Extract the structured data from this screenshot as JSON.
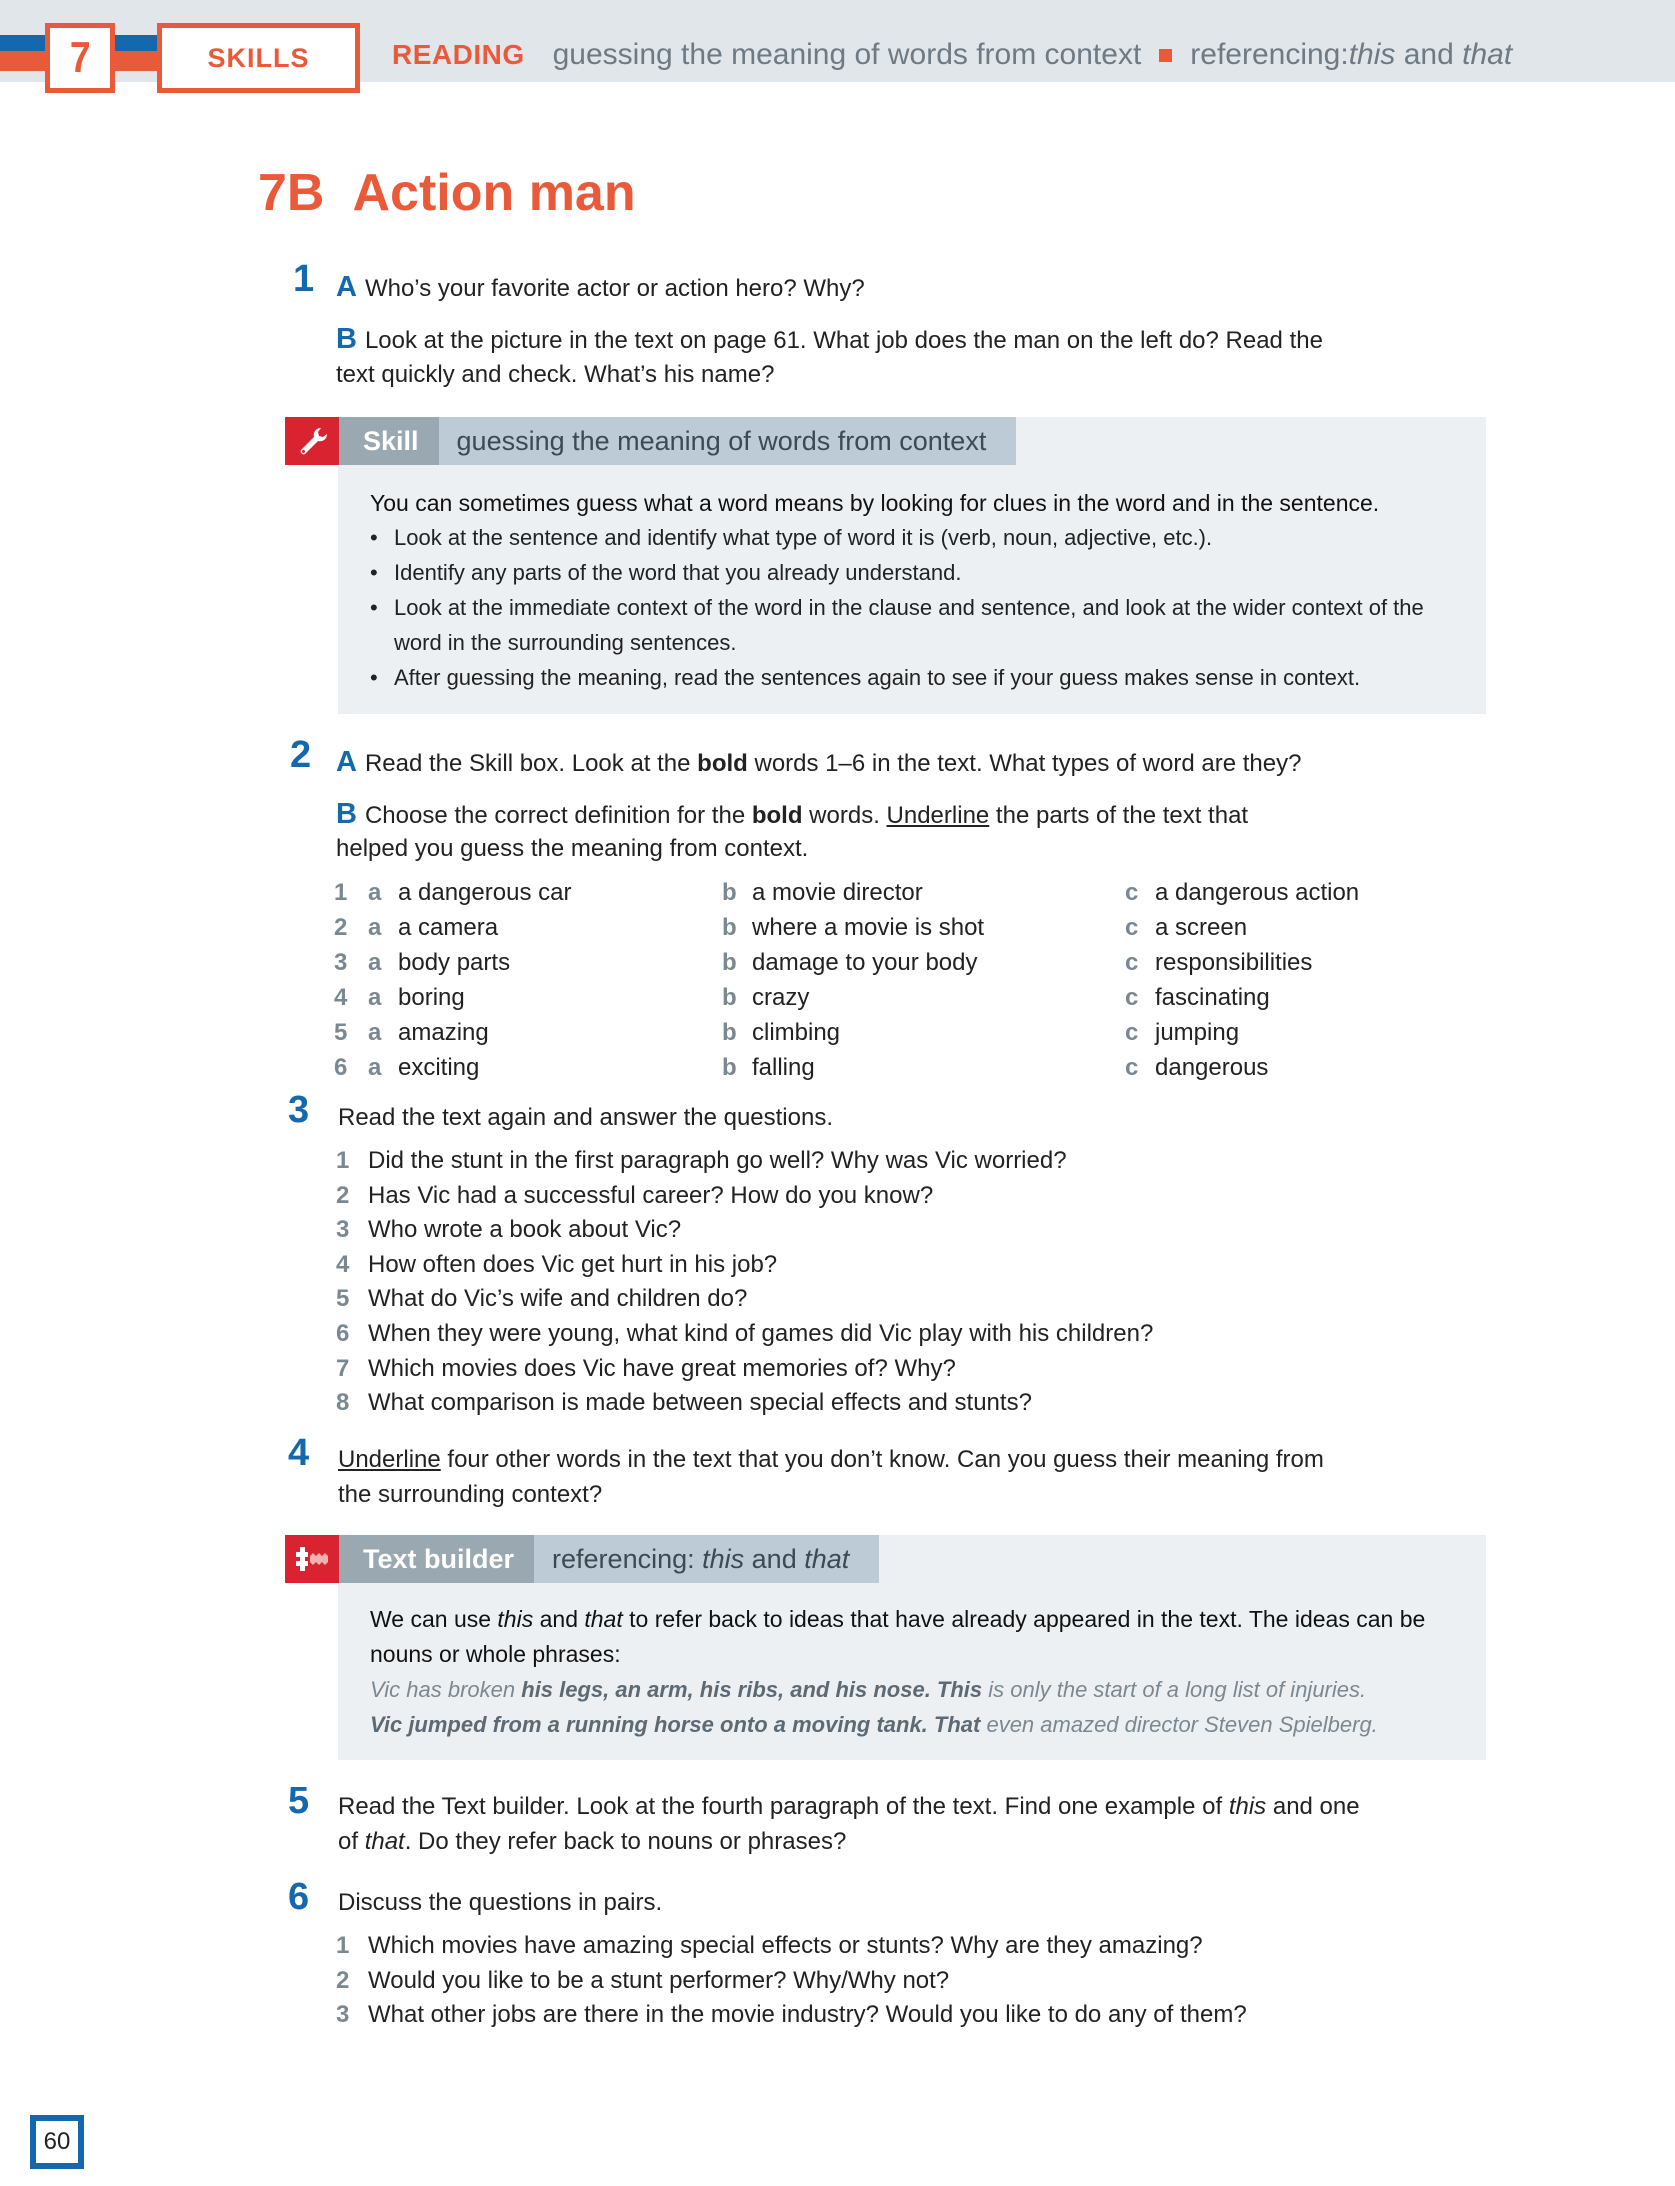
{
  "header": {
    "unit_number": "7",
    "section_label": "SKILLS",
    "reading_label": "READING",
    "topic_1": "guessing the meaning of words from context",
    "topic_2_prefix": "referencing: ",
    "topic_2_this": "this",
    "topic_2_and": " and ",
    "topic_2_that": "that",
    "colors": {
      "orange": "#e95a3b",
      "blue": "#1468ad",
      "band": "#e1e6ea"
    }
  },
  "title": {
    "code": "7B",
    "text": "Action man"
  },
  "ex1": {
    "number": "1",
    "a_letter": "A",
    "a_text": "Who’s your favorite actor or action hero? Why?",
    "b_letter": "B",
    "b_line1": "Look at the picture in the text on page 61. What job does the man on the left do? Read the",
    "b_line2": "text quickly and check. What’s his name?"
  },
  "skill_box": {
    "icon": "wrench-icon",
    "label": "Skill",
    "topic": "guessing the meaning of words from context",
    "intro": "You can sometimes guess what a word means by looking for clues in the word and in the sentence.",
    "bullets": [
      "Look at the sentence and identify what type of word it is (verb, noun, adjective, etc.).",
      "Identify any parts of the word that you already understand.",
      "Look at the immediate context of the word in the clause and sentence, and look at the wider context of the word in the surrounding sentences.",
      "After guessing the meaning, read the sentences again to see if your guess makes sense in context."
    ]
  },
  "ex2": {
    "number": "2",
    "a_letter": "A",
    "a_pre": "Read the Skill box. Look at the ",
    "a_bold": "bold",
    "a_post": " words 1–6 in the text. What types of word are they?",
    "b_letter": "B",
    "b_pre": "Choose the correct definition for the ",
    "b_bold": "bold",
    "b_mid": " words. ",
    "b_underline": "Underline",
    "b_post": " the parts of the text that",
    "b_line2": "helped you guess the meaning from context.",
    "options": [
      {
        "n": "1",
        "a": "a dangerous car",
        "b": "a movie director",
        "c": "a dangerous action"
      },
      {
        "n": "2",
        "a": "a camera",
        "b": "where a movie is shot",
        "c": "a screen"
      },
      {
        "n": "3",
        "a": "body parts",
        "b": "damage to your body",
        "c": "responsibilities"
      },
      {
        "n": "4",
        "a": "boring",
        "b": "crazy",
        "c": "fascinating"
      },
      {
        "n": "5",
        "a": "amazing",
        "b": "climbing",
        "c": "jumping"
      },
      {
        "n": "6",
        "a": "exciting",
        "b": "falling",
        "c": "dangerous"
      }
    ],
    "letters": {
      "a": "a",
      "b": "b",
      "c": "c"
    }
  },
  "ex3": {
    "number": "3",
    "instruction": "Read the text again and answer the questions.",
    "questions": [
      {
        "n": "1",
        "text": "Did the stunt in the first paragraph go well? Why was Vic worried?"
      },
      {
        "n": "2",
        "text": "Has Vic had a successful career? How do you know?"
      },
      {
        "n": "3",
        "text": "Who wrote a book about Vic?"
      },
      {
        "n": "4",
        "text": "How often does Vic get hurt in his job?"
      },
      {
        "n": "5",
        "text": "What do Vic’s wife and children do?"
      },
      {
        "n": "6",
        "text": "When they were young, what kind of games did Vic play with his children?"
      },
      {
        "n": "7",
        "text": "Which movies does Vic have great memories of? Why?"
      },
      {
        "n": "8",
        "text": "What comparison is made between special effects and stunts?"
      }
    ]
  },
  "ex4": {
    "number": "4",
    "underline": "Underline",
    "line1_post": " four other words in the text that you don’t know. Can you guess their meaning from",
    "line2": "the surrounding context?"
  },
  "text_builder": {
    "icon": "puzzle-icon",
    "label": "Text builder",
    "topic_prefix": "referencing: ",
    "topic_this": "this",
    "topic_and": " and ",
    "topic_that": "that",
    "intro_1": "We can use ",
    "intro_this": "this",
    "intro_2": " and ",
    "intro_that": "that",
    "intro_3": " to refer back to ideas that have already appeared in the text. The ideas can be",
    "intro_line2": "nouns or whole phrases:",
    "ex1_pre": "Vic has broken ",
    "ex1_bold": "his legs, an arm, his ribs, and his nose. This",
    "ex1_post": " is only the start of a long list of injuries.",
    "ex2_bold": "Vic jumped from a running horse onto a moving tank. That",
    "ex2_post": " even amazed director Steven Spielberg."
  },
  "ex5": {
    "number": "5",
    "line1_pre": "Read the Text builder. Look at the fourth paragraph of the text. Find one example of ",
    "line1_this": "this",
    "line1_post": " and one",
    "line2_pre": "of ",
    "line2_that": "that",
    "line2_post": ". Do they refer back to nouns or phrases?"
  },
  "ex6": {
    "number": "6",
    "instruction": "Discuss the questions in pairs.",
    "questions": [
      {
        "n": "1",
        "text": "Which movies have amazing special effects or stunts? Why are they amazing?"
      },
      {
        "n": "2",
        "text": "Would you like to be a stunt performer? Why/Why not?"
      },
      {
        "n": "3",
        "text": "What other jobs are there in the movie industry? Would you like to do any of them?"
      }
    ]
  },
  "page_number": "60"
}
